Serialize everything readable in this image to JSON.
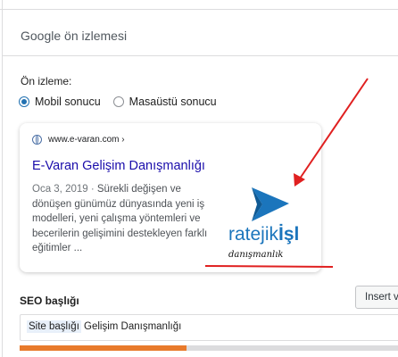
{
  "section": {
    "title": "Google ön izlemesi"
  },
  "preview": {
    "label": "Ön izleme:",
    "options": [
      "Mobil sonucu",
      "Masaüstü sonucu"
    ],
    "selected": "Mobil sonucu"
  },
  "result": {
    "url": "www.e-varan.com ›",
    "title": "E-Varan Gelişim Danışmanlığı",
    "date": "Oca 3, 2019 ·",
    "snippet_lines": [
      "Sürekli değişen ve",
      "dönüşen günümüz dünyasında yeni iş",
      "modelleri, yeni çalışma yöntemleri ve",
      "becerilerin gelişimini destekleyen farklı",
      "eğitimler ..."
    ],
    "logo": {
      "brand_a": "ratejik",
      "brand_b": "İşl",
      "tagline": "danışmanlık"
    }
  },
  "seo": {
    "label": "SEO başlığı",
    "insert_button": "Insert variable",
    "chip": "Site başlığı",
    "value": "Gelişim Danışmanlığı",
    "progress": 0.44,
    "progress_color": "#e87a2b"
  },
  "colors": {
    "link": "#1a0dab",
    "accent": "#2271b1",
    "annotation": "#e02020",
    "logo_blue": "#1b75bc"
  },
  "icons": {
    "site": "globe-icon"
  }
}
